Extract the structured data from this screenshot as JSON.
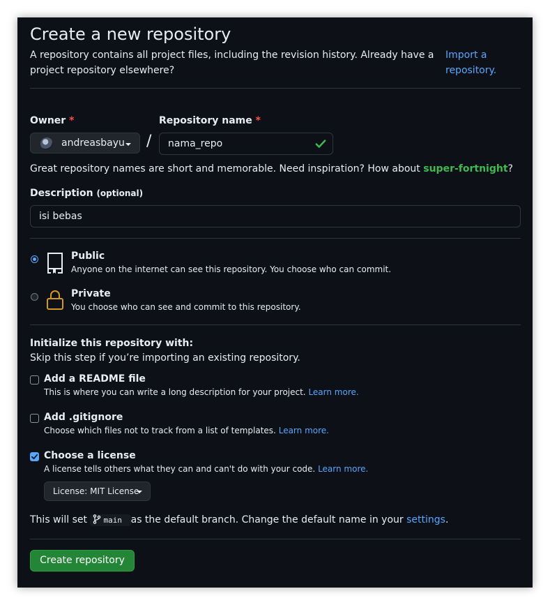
{
  "header": {
    "title": "Create a new repository",
    "subtitle": "A repository contains all project files, including the revision history. Already have a project repository elsewhere?",
    "import_link_line1": "Import a",
    "import_link_line2": "repository."
  },
  "owner": {
    "label": "Owner",
    "required_mark": "*",
    "value": "andreasbayu"
  },
  "separator": "/",
  "repo_name": {
    "label": "Repository name",
    "required_mark": "*",
    "value": "nama_repo"
  },
  "suggestion": {
    "text": "Great repository names are short and memorable. Need inspiration? How about",
    "name": "super-fortnight",
    "suffix": "?"
  },
  "description": {
    "label": "Description",
    "optional": "(optional)",
    "value": "isi bebas"
  },
  "visibility": {
    "public": {
      "title": "Public",
      "desc": "Anyone on the internet can see this repository. You choose who can commit.",
      "selected": true
    },
    "private": {
      "title": "Private",
      "desc": "You choose who can see and commit to this repository.",
      "selected": false
    }
  },
  "init": {
    "heading": "Initialize this repository with:",
    "subheading": "Skip this step if you’re importing an existing repository.",
    "readme": {
      "title": "Add a README file",
      "desc": "This is where you can write a long description for your project.",
      "link": "Learn more.",
      "checked": false
    },
    "gitignore": {
      "title": "Add .gitignore",
      "desc": "Choose which files not to track from a list of templates.",
      "link": "Learn more.",
      "checked": false
    },
    "license": {
      "title": "Choose a license",
      "desc": "A license tells others what they can and can't do with your code.",
      "link": "Learn more.",
      "checked": true,
      "dropdown": "License: MIT License"
    }
  },
  "branch": {
    "prefix": "This will set",
    "name": "main",
    "middle": "as the default branch. Change the default name in your",
    "link": "settings",
    "suffix": "."
  },
  "submit": {
    "label": "Create repository"
  },
  "colors": {
    "background": "#0d1117",
    "accent": "#58a6ff",
    "success": "#3fb950",
    "primary_button": "#238636",
    "danger": "#f85149",
    "lock_icon": "#d29922"
  }
}
